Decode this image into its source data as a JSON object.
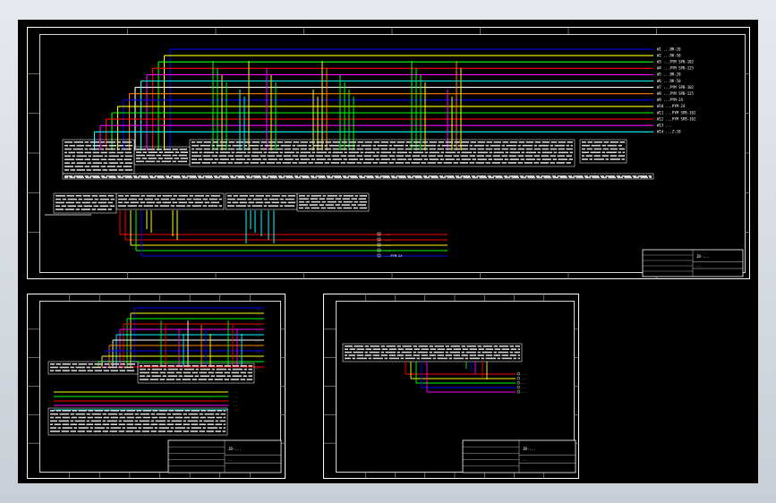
{
  "colors": {
    "background": "#000000",
    "frame": "#d8d8d8",
    "table": "#e0e0e0",
    "wires": [
      "#0000ff",
      "#ffff00",
      "#00ff00",
      "#ff0000",
      "#ff00ff",
      "#00ffff",
      "#ffffff",
      "#ff8000"
    ]
  },
  "sheet_main": {
    "wire_labels": [
      "W1 ...BR-20",
      "W2 ...RK-50",
      "W3 ...PYM SPB-102",
      "W4 ...PYM SPB-125",
      "W5 ...BR-20",
      "W6 ...RK-50",
      "W7 ...PYM SPB-102",
      "W8 ...PYM SPB-125",
      "W9 ...PYM-24",
      "W10 ...PYM-24",
      "W11 ...PYM SPB-102",
      "W12 ...PYM SPB-102",
      "W13 ...",
      "W14 ...Z-20"
    ],
    "lower_labels": [
      "...",
      "...",
      "...",
      "...",
      "...PYM-24"
    ],
    "title": "JB-...",
    "drawing_no": "...",
    "sheet_info": "..."
  },
  "sheet_left": {
    "title": "JB-...",
    "drawing_no": "..."
  },
  "sheet_right": {
    "title": "JB-...",
    "drawing_no": "...",
    "wire_labels": [
      "...",
      "...",
      "...",
      "...",
      "..."
    ]
  }
}
